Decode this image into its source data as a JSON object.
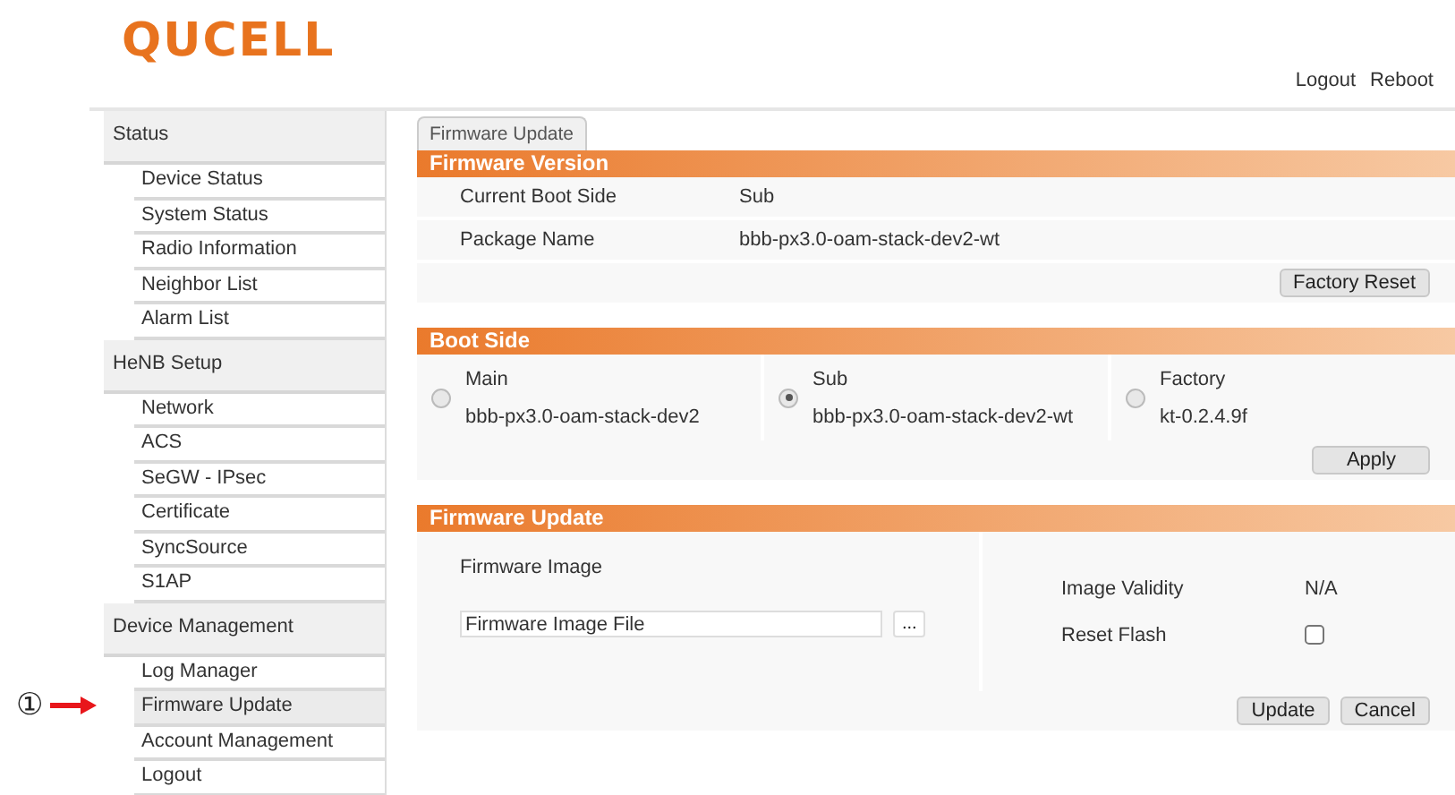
{
  "logo": "QUCELL",
  "header_links": [
    "Logout",
    "Reboot"
  ],
  "sidebar": {
    "groups": [
      {
        "label": "Status",
        "items": [
          {
            "label": "Device Status",
            "selected": false
          },
          {
            "label": "System Status",
            "selected": false
          },
          {
            "label": "Radio Information",
            "selected": false
          },
          {
            "label": "Neighbor List",
            "selected": false
          },
          {
            "label": "Alarm List",
            "selected": false
          }
        ]
      },
      {
        "label": "HeNB Setup",
        "items": [
          {
            "label": "Network",
            "selected": false
          },
          {
            "label": "ACS",
            "selected": false
          },
          {
            "label": "SeGW - IPsec",
            "selected": false
          },
          {
            "label": "Certificate",
            "selected": false
          },
          {
            "label": "SyncSource",
            "selected": false
          },
          {
            "label": "S1AP",
            "selected": false
          }
        ]
      },
      {
        "label": "Device Management",
        "items": [
          {
            "label": "Log Manager",
            "selected": false
          },
          {
            "label": "Firmware Update",
            "selected": true
          },
          {
            "label": "Account Management",
            "selected": false
          },
          {
            "label": "Logout",
            "selected": false
          }
        ]
      }
    ]
  },
  "annotation": {
    "marker": "①"
  },
  "tabs": [
    {
      "label": "Firmware Update",
      "selected": true
    }
  ],
  "firmware_version": {
    "title": "Firmware Version",
    "rows": [
      {
        "label": "Current Boot Side",
        "value": "Sub"
      },
      {
        "label": "Package Name",
        "value": "bbb-px3.0-oam-stack-dev2-wt"
      }
    ],
    "button": "Factory Reset"
  },
  "boot_side": {
    "title": "Boot Side",
    "options": [
      {
        "label": "Main",
        "value": "bbb-px3.0-oam-stack-dev2",
        "selected": false
      },
      {
        "label": "Sub",
        "value": "bbb-px3.0-oam-stack-dev2-wt",
        "selected": true
      },
      {
        "label": "Factory",
        "value": "kt-0.2.4.9f",
        "selected": false
      }
    ],
    "button": "Apply"
  },
  "firmware_update": {
    "title": "Firmware Update",
    "image_label": "Firmware Image",
    "file_field": {
      "value": "Firmware Image File"
    },
    "browse_button": "...",
    "validity_label": "Image Validity",
    "validity_value": "N/A",
    "reset_flash": {
      "label": "Reset Flash",
      "checked": false
    },
    "buttons": [
      "Update",
      "Cancel"
    ]
  }
}
